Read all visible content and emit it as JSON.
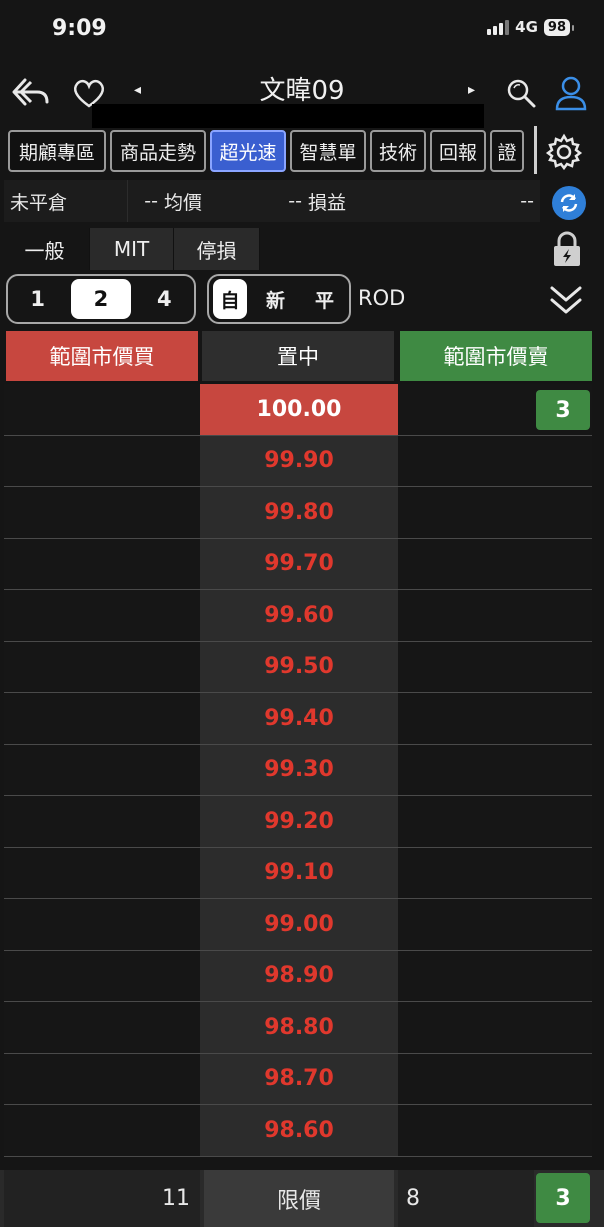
{
  "status": {
    "time": "9:09",
    "network": "4G",
    "battery": "98"
  },
  "nav": {
    "title": "文暐09"
  },
  "tabs": [
    {
      "label": "期顧專區",
      "active": false
    },
    {
      "label": "商品走勢",
      "active": false
    },
    {
      "label": "超光速",
      "active": true
    },
    {
      "label": "智慧單",
      "active": false
    },
    {
      "label": "技術",
      "active": false
    },
    {
      "label": "回報",
      "active": false
    },
    {
      "label": "證",
      "active": false
    }
  ],
  "position": {
    "label": "未平倉",
    "qty": "--",
    "avg_label": "均價",
    "avg": "--",
    "pnl_label": "損益",
    "pnl": "--"
  },
  "order_tabs": [
    {
      "label": "一般"
    },
    {
      "label": "MIT"
    },
    {
      "label": "停損"
    }
  ],
  "lots": {
    "options": [
      "1",
      "2",
      "4"
    ],
    "selected": "2"
  },
  "open_close": {
    "options": [
      "自",
      "新",
      "平"
    ],
    "selected": "自"
  },
  "order_type": "ROD",
  "actions": {
    "buy": "範圍市價買",
    "center": "置中",
    "sell": "範圍市價賣"
  },
  "ladder": [
    {
      "price": "100.00",
      "sell_qty": "3"
    },
    {
      "price": "99.90"
    },
    {
      "price": "99.80"
    },
    {
      "price": "99.70"
    },
    {
      "price": "99.60"
    },
    {
      "price": "99.50"
    },
    {
      "price": "99.40"
    },
    {
      "price": "99.30"
    },
    {
      "price": "99.20"
    },
    {
      "price": "99.10"
    },
    {
      "price": "99.00"
    },
    {
      "price": "98.90"
    },
    {
      "price": "98.80"
    },
    {
      "price": "98.70"
    },
    {
      "price": "98.60"
    }
  ],
  "bottom": {
    "buy_total": "11",
    "limit_label": "限價",
    "sell_total": "8",
    "sell_badge": "3"
  },
  "colors": {
    "buy_red": "#c7473f",
    "sell_green": "#3f8a43",
    "active_blue": "#3a5fd0",
    "price_red": "#e0382d"
  },
  "icons": [
    "back-icon",
    "heart-icon",
    "search-icon",
    "user-icon",
    "gear-icon",
    "refresh-icon",
    "lock-icon",
    "chevron-double-down-icon"
  ]
}
